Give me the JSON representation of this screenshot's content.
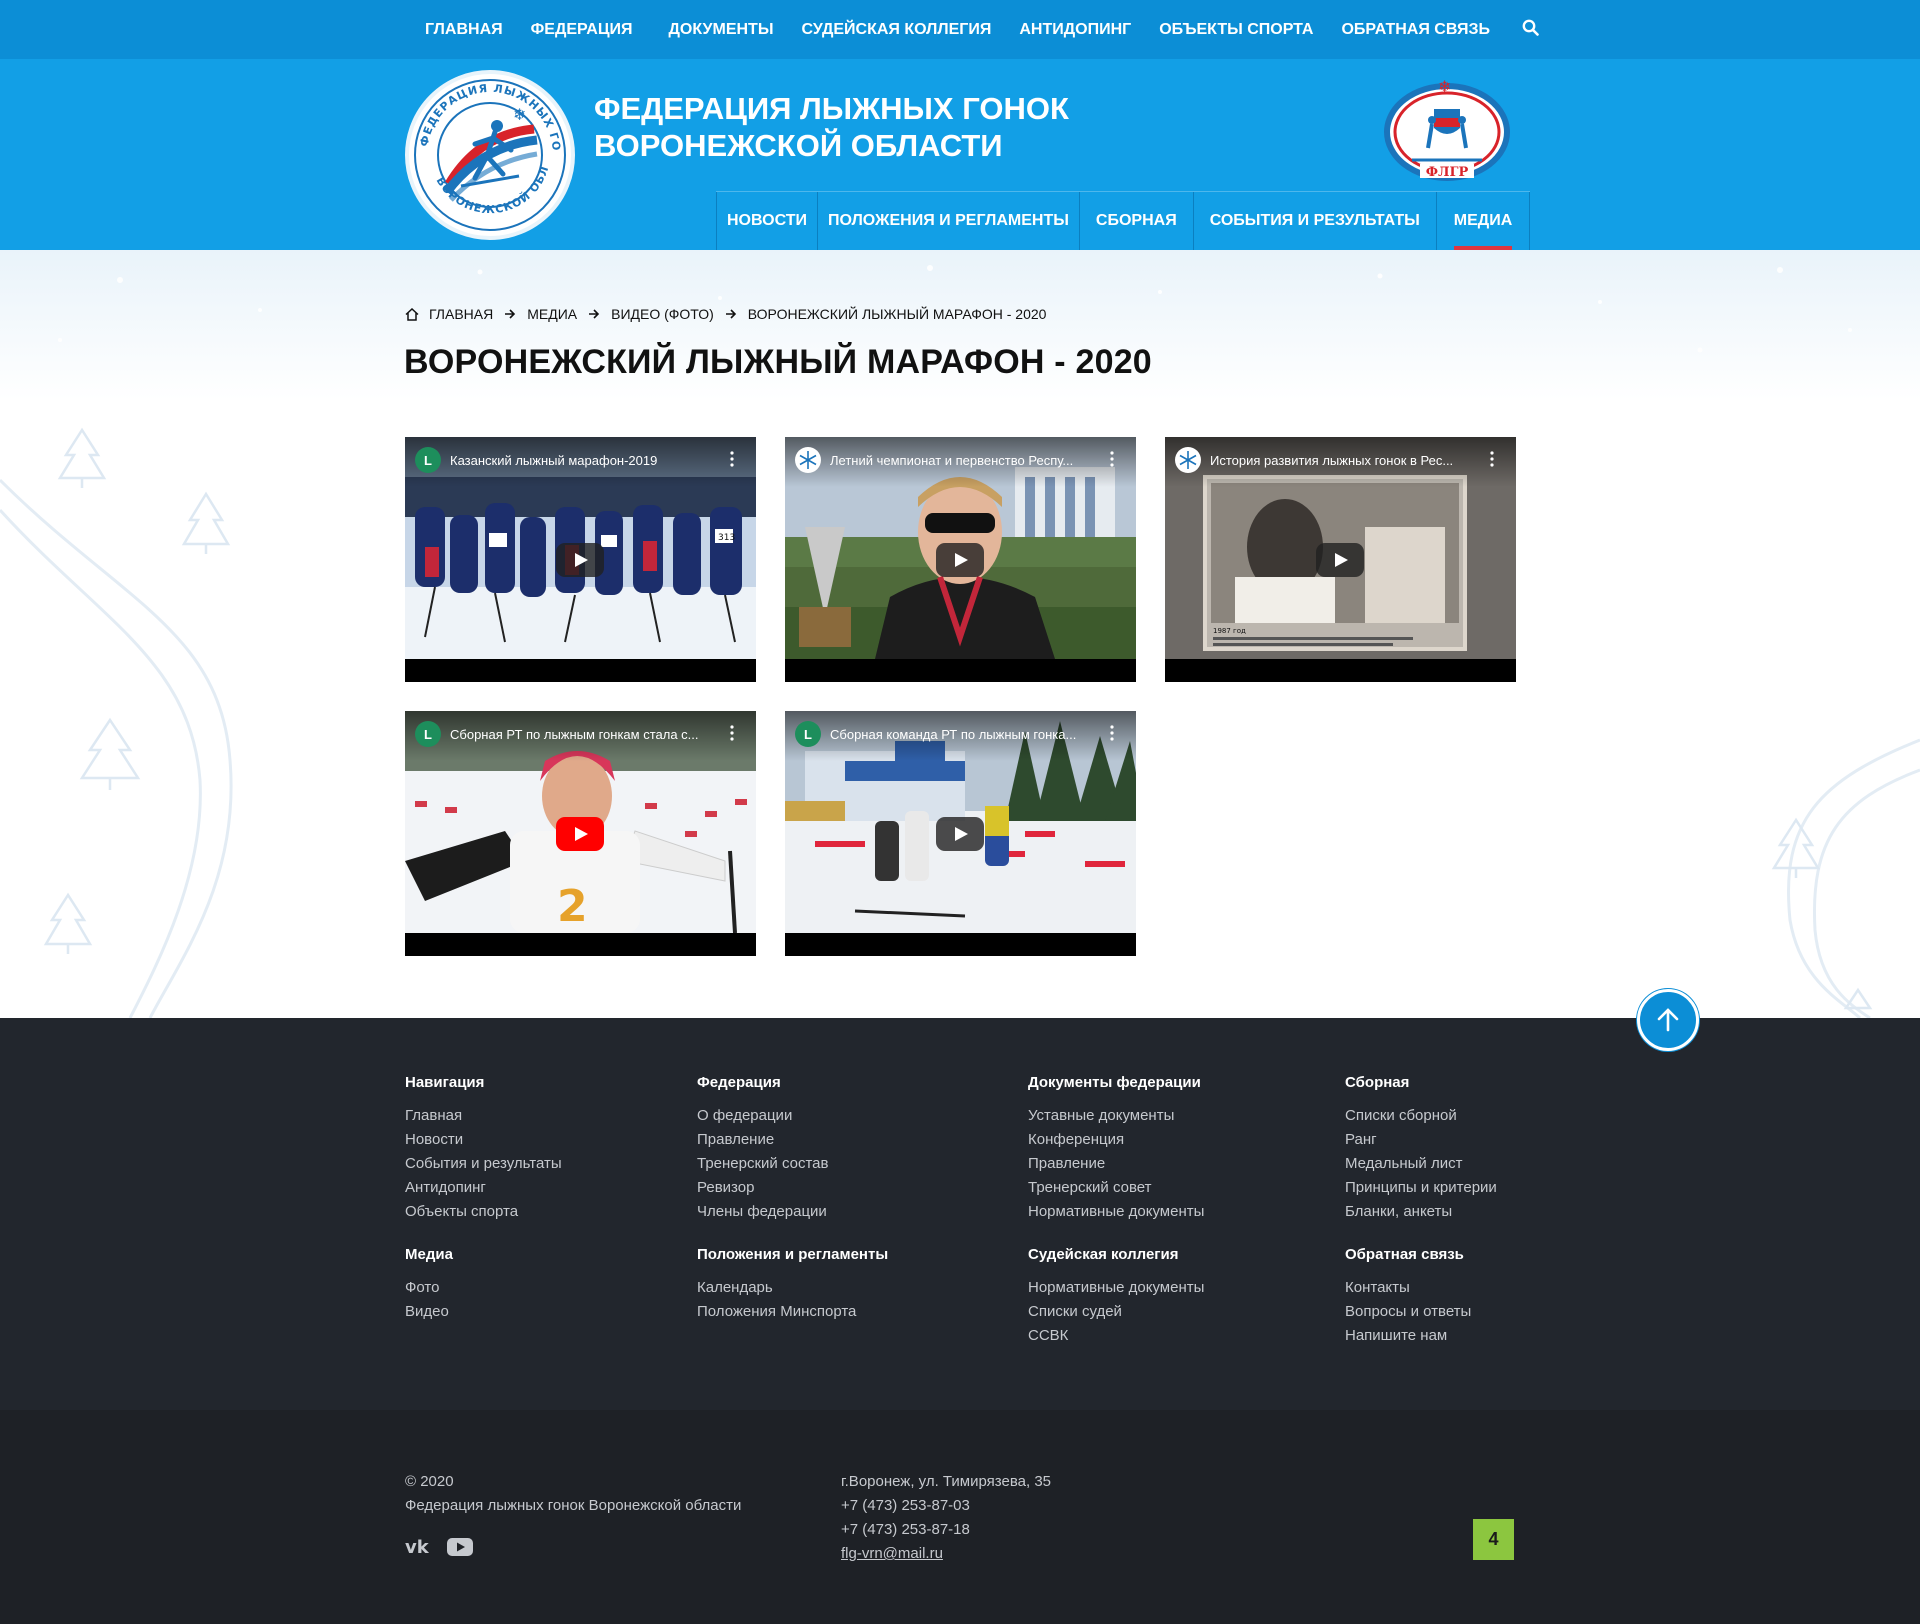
{
  "top_nav": {
    "items": [
      "ГЛАВНАЯ",
      "ФЕДЕРАЦИЯ",
      "ДОКУМЕНТЫ",
      "СУДЕЙСКАЯ КОЛЛЕГИЯ",
      "АНТИДОПИНГ",
      "ОБЪЕКТЫ СПОРТА",
      "ОБРАТНАЯ СВЯЗЬ"
    ],
    "search_icon": "search-icon"
  },
  "header": {
    "title_line1": "ФЕДЕРАЦИЯ ЛЫЖНЫХ ГОНОК",
    "title_line2": "ВОРОНЕЖСКОЙ ОБЛАСТИ",
    "logo_ring_text": "ФЕДЕРАЦИЯ ЛЫЖНЫХ ГОНОК ВОРОНЕЖСКОЙ ОБЛАСТИ",
    "partner_logo_text": "ФЛГР"
  },
  "main_nav": {
    "items": [
      "НОВОСТИ",
      "ПОЛОЖЕНИЯ И РЕГЛАМЕНТЫ",
      "СБОРНАЯ",
      "СОБЫТИЯ И РЕЗУЛЬТАТЫ",
      "МЕДИА"
    ],
    "active": "МЕДИА"
  },
  "breadcrumb": [
    "ГЛАВНАЯ",
    "МЕДИА",
    "ВИДЕО (ФОТО)",
    "ВОРОНЕЖСКИЙ ЛЫЖНЫЙ МАРАФОН - 2020"
  ],
  "page_title": "ВОРОНЕЖСКИЙ ЛЫЖНЫЙ МАРАФОН - 2020",
  "videos": [
    {
      "title": "Казанский лыжный марафон-2019",
      "channel_initial": "L",
      "channel_color": "#1d8e5c"
    },
    {
      "title": "Летний чемпионат и первенство Респу...",
      "channel_initial": "",
      "channel_color": "#ffffff"
    },
    {
      "title": "История развития лыжных гонок в Рес...",
      "channel_initial": "",
      "channel_color": "#ffffff"
    },
    {
      "title": "Сборная РТ по лыжным гонкам стала с...",
      "channel_initial": "L",
      "channel_color": "#1d8e5c"
    },
    {
      "title": "Сборная команда РТ по лыжным гонка...",
      "channel_initial": "L",
      "channel_color": "#1d8e5c"
    }
  ],
  "video_overlay_texts": {
    "photo_caption_year": "1987 год",
    "bib_number": "313",
    "bib_2": "2"
  },
  "footer": {
    "columns": [
      {
        "heading": "Навигация",
        "links": [
          "Главная",
          "Новости",
          "События и результаты",
          "Антидопинг",
          "Объекты спорта"
        ]
      },
      {
        "heading": "Федерация",
        "links": [
          "О федерации",
          "Правление",
          "Тренерский состав",
          "Ревизор",
          "Члены федерации"
        ]
      },
      {
        "heading": "Документы федерации",
        "links": [
          "Уставные документы",
          "Конференция",
          "Правление",
          "Тренерский совет",
          "Нормативные документы"
        ]
      },
      {
        "heading": "Сборная",
        "links": [
          "Списки сборной",
          "Ранг",
          "Медальный лист",
          "Принципы и критерии",
          "Бланки, анкеты"
        ]
      },
      {
        "heading": "Медиа",
        "links": [
          "Фото",
          "Видео"
        ]
      },
      {
        "heading": "Положения и регламенты",
        "links": [
          "Календарь",
          "Положения Минспорта"
        ]
      },
      {
        "heading": "Судейская коллегия",
        "links": [
          "Нормативные документы",
          "Списки судей",
          "ССВК"
        ]
      },
      {
        "heading": "Обратная связь",
        "links": [
          "Контакты",
          "Вопросы и ответы",
          "Напишите нам"
        ]
      }
    ],
    "copyright_year": "© 2020",
    "copyright_org": "Федерация лыжных гонок Воронежской области",
    "address": "г.Воронеж, ул. Тимирязева, 35",
    "phone1": "+7 (473) 253-87-03",
    "phone2": "+7 (473) 253-87-18",
    "email": "flg-vrn@mail.ru",
    "counter": "4",
    "social": [
      "vk-icon",
      "youtube-icon"
    ]
  },
  "colors": {
    "topbar": "#0c8ed6",
    "header": "#129fe6",
    "accent_red": "#e03540",
    "footer": "#22262d",
    "footer_bottom": "#1e2126",
    "counter_green": "#8cc63f"
  }
}
